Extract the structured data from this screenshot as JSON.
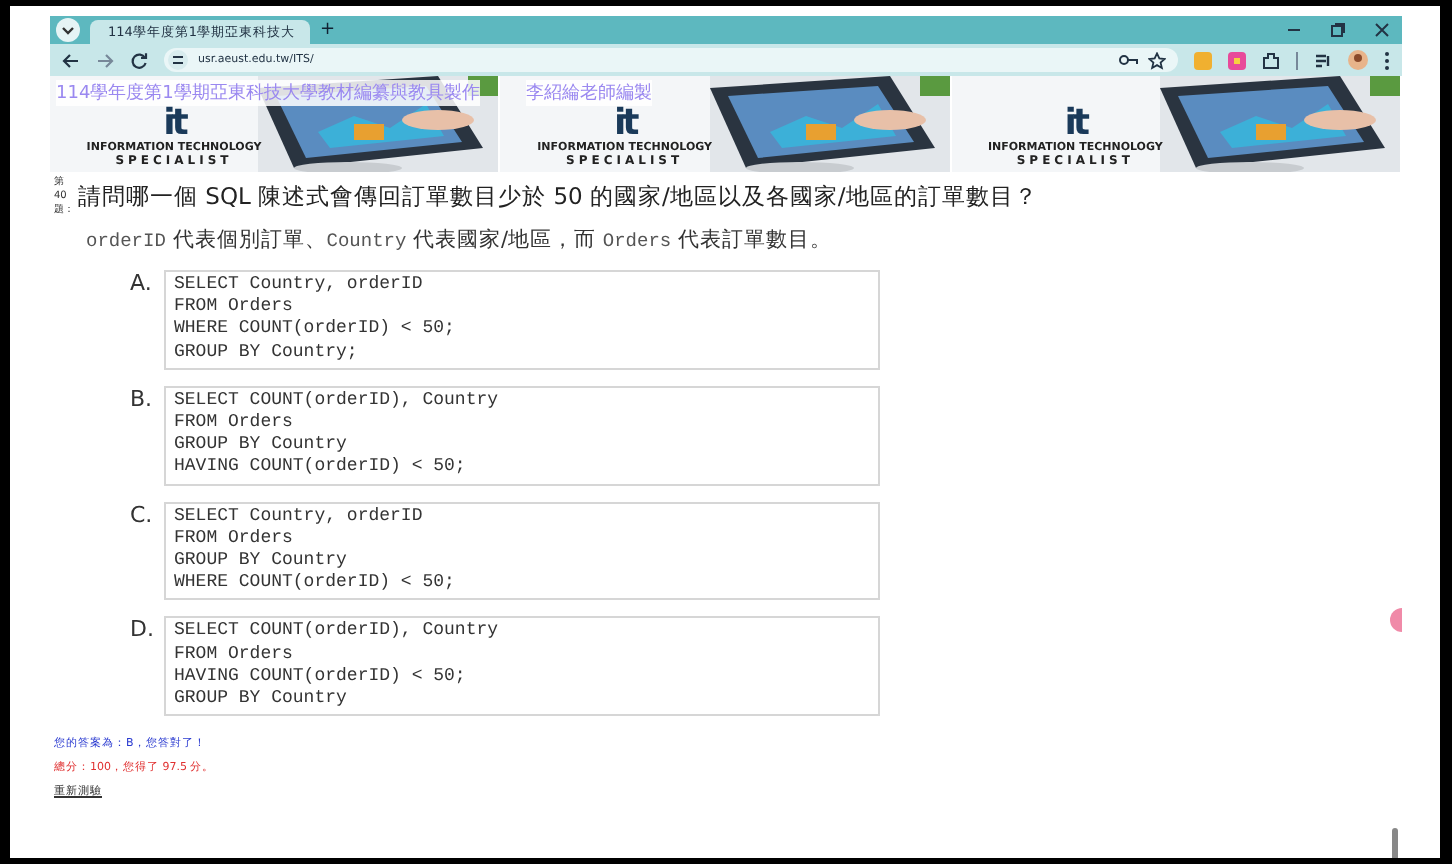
{
  "browser": {
    "tab": {
      "title": "114學年度第1學期亞東科技大",
      "selected": true
    },
    "new_tab": "+",
    "url": "usr.aeust.edu.tw/ITS/"
  },
  "banner": {
    "title": "114學年度第1學期亞東科技大學教材編纂與教具製作",
    "author": "李紹綸老師編製",
    "panels": [
      {
        "logo": "it",
        "caption": "INFORMATION TECHNOLOGY",
        "subcaption": "SPECIALIST"
      },
      {
        "logo": "it",
        "caption": "INFORMATION TECHNOLOGY",
        "subcaption": "SPECIALIST"
      },
      {
        "logo": "it",
        "caption": "INFORMATION TECHNOLOGY",
        "subcaption": "SPECIALIST"
      }
    ]
  },
  "question": {
    "number_label": "第40題：",
    "text": "請問哪一個 SQL 陳述式會傳回訂單數目少於 50 的國家/地區以及各國家/地區的訂單數目？",
    "note": [
      {
        "kind": "code",
        "text": "orderID"
      },
      {
        "kind": "plain",
        "text": " 代表個別訂單、"
      },
      {
        "kind": "code",
        "text": "Country"
      },
      {
        "kind": "plain",
        "text": " 代表國家/地區，而 "
      },
      {
        "kind": "code",
        "text": "Orders"
      },
      {
        "kind": "plain",
        "text": " 代表訂單數目。"
      }
    ]
  },
  "options": [
    {
      "letter": "A.",
      "lines": [
        "SELECT Country, orderID",
        "FROM Orders",
        "WHERE COUNT(orderID) < 50;",
        "GROUP BY Country;"
      ]
    },
    {
      "letter": "B.",
      "lines": [
        "SELECT COUNT(orderID), Country",
        "FROM Orders",
        "GROUP BY Country",
        "HAVING COUNT(orderID) < 50;"
      ]
    },
    {
      "letter": "C.",
      "lines": [
        "SELECT Country, orderID",
        "FROM Orders",
        "GROUP BY Country",
        "WHERE COUNT(orderID) < 50;"
      ]
    },
    {
      "letter": "D.",
      "lines": [
        "SELECT COUNT(orderID), Country",
        "FROM Orders",
        "HAVING COUNT(orderID) < 50;",
        "GROUP BY Country"
      ]
    }
  ],
  "result": {
    "answer": "您的答案為：B，您答對了！",
    "score": "總分：100，您得了 97.5 分。",
    "retry": "重新測驗"
  }
}
